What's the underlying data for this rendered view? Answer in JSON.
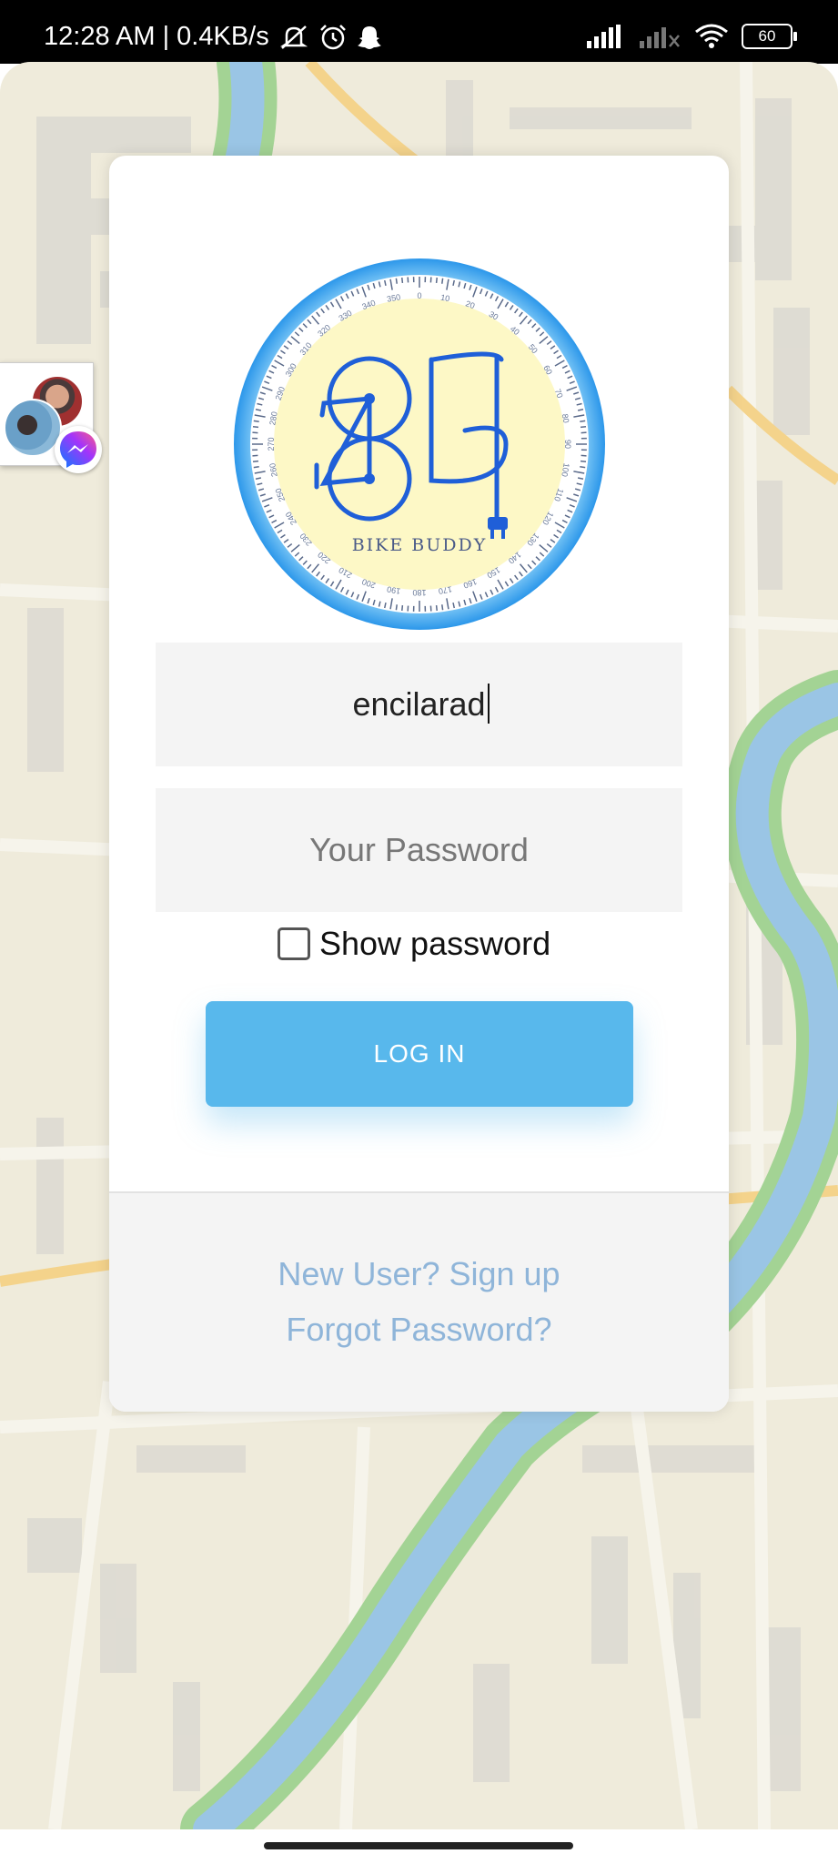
{
  "status_bar": {
    "time_and_speed": "12:28 AM | 0.4KB/s",
    "battery_level": "60"
  },
  "logo": {
    "text": "BIKE BUDDY",
    "dial_numbers": [
      "0",
      "10",
      "20",
      "30",
      "40",
      "50",
      "60",
      "70",
      "80",
      "90",
      "100",
      "110",
      "120",
      "130",
      "140",
      "150",
      "160",
      "170",
      "180",
      "190",
      "200",
      "210",
      "220",
      "230",
      "240",
      "250",
      "260",
      "270",
      "280",
      "290",
      "300",
      "310",
      "320",
      "330",
      "340",
      "350"
    ]
  },
  "login": {
    "username_value": "encilarad",
    "password_placeholder": "Your Password",
    "show_password_label": "Show password",
    "login_button_label": "LOG IN"
  },
  "footer": {
    "signup_label": "New User? Sign up",
    "forgot_label": "Forgot Password?"
  },
  "colors": {
    "accent": "#58b8ec",
    "link": "#8fb5d9",
    "logo_blue": "#1f5fd8",
    "logo_ring": "#3aa9f0"
  },
  "icons": [
    "mute-icon",
    "alarm-icon",
    "snapchat-icon",
    "signal-icon",
    "wifi-icon",
    "battery-icon",
    "messenger-icon"
  ]
}
